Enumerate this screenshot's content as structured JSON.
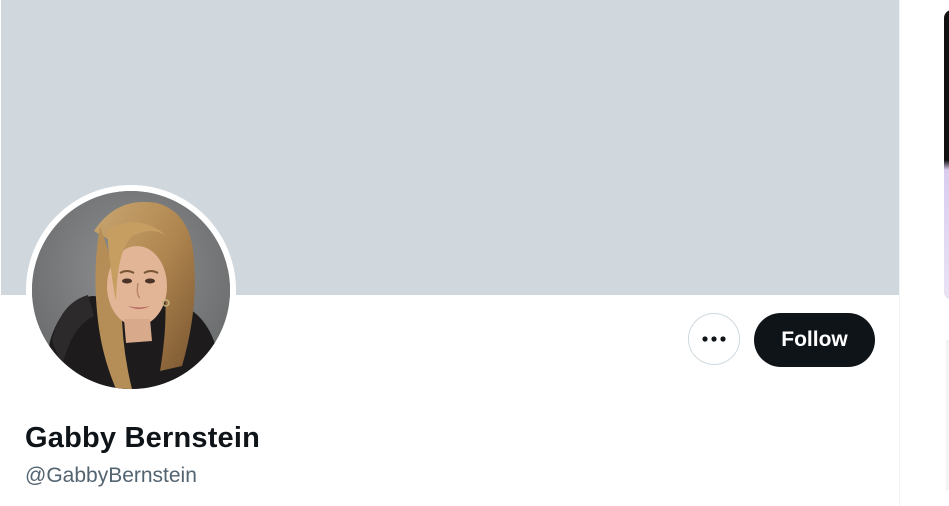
{
  "profile": {
    "display_name": "Gabby Bernstein",
    "handle": "@GabbyBernstein"
  },
  "actions": {
    "more_icon": "more-horizontal-icon",
    "follow_label": "Follow"
  },
  "colors": {
    "banner": "#d0d8de",
    "follow_button_bg": "#0f1419",
    "follow_button_text": "#ffffff",
    "name_text": "#0f1419",
    "handle_text": "#536471"
  }
}
